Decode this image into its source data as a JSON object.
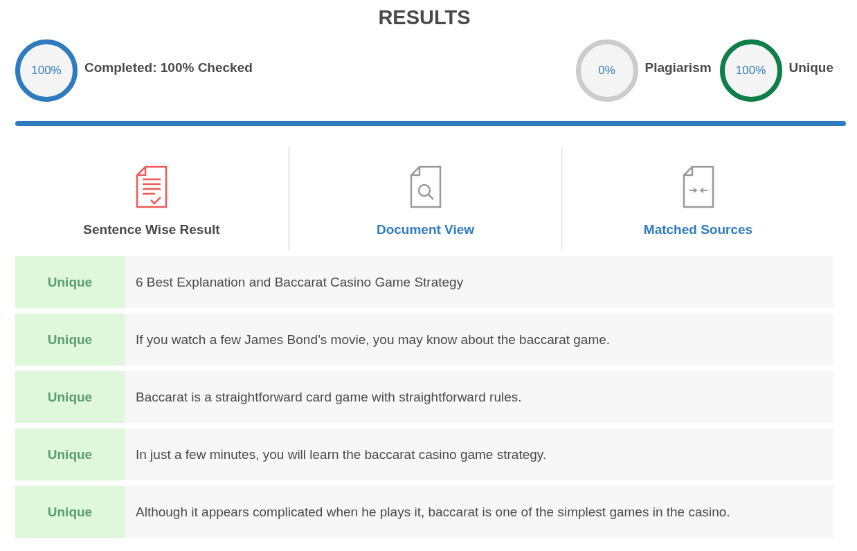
{
  "title": "RESULTS",
  "progress": {
    "value": "100%",
    "label": "Completed: 100% Checked",
    "color": "#2f7bbf",
    "level": 1
  },
  "scores": [
    {
      "value": "0%",
      "label": "Plagiarism",
      "color": "#cccccc"
    },
    {
      "value": "100%",
      "label": "Unique",
      "color": "#0f7f48"
    }
  ],
  "tabs": [
    {
      "label": "Sentence Wise Result",
      "kind": "sentences",
      "selected": true
    },
    {
      "label": "Document View",
      "kind": "document",
      "selected": false
    },
    {
      "label": "Matched Sources",
      "kind": "sources",
      "selected": false
    }
  ],
  "sentences": [
    {
      "status": "Unique",
      "text": "6 Best Explanation and Baccarat Casino Game Strategy"
    },
    {
      "status": "Unique",
      "text": "If you watch a few James Bond’s movie, you may know about the baccarat game."
    },
    {
      "status": "Unique",
      "text": "Baccarat is a straightforward card game with straightforward rules."
    },
    {
      "status": "Unique",
      "text": "In just a few minutes, you will learn the baccarat casino game strategy."
    },
    {
      "status": "Unique",
      "text": "Although it appears complicated when he plays it, baccarat is one of the simplest games in the casino."
    }
  ]
}
